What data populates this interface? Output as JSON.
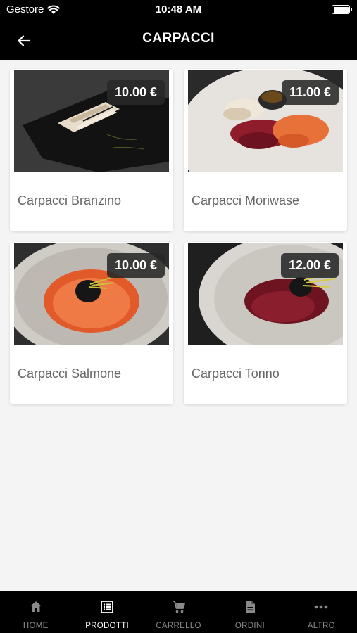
{
  "status": {
    "carrier": "Gestore",
    "time": "10:48 AM"
  },
  "header": {
    "title": "CARPACCI"
  },
  "products": [
    {
      "name": "Carpacci Branzino",
      "price": "10.00 €"
    },
    {
      "name": "Carpacci Moriwase",
      "price": "11.00 €"
    },
    {
      "name": "Carpacci Salmone",
      "price": "10.00 €"
    },
    {
      "name": "Carpacci Tonno",
      "price": "12.00 €"
    }
  ],
  "tabs": [
    {
      "label": "HOME",
      "icon": "home-icon"
    },
    {
      "label": "PRODOTTI",
      "icon": "list-icon",
      "active": true
    },
    {
      "label": "CARRELLO",
      "icon": "cart-icon"
    },
    {
      "label": "ORDINI",
      "icon": "document-icon"
    },
    {
      "label": "ALTRO",
      "icon": "more-icon"
    }
  ],
  "colors": {
    "bar": "#000000",
    "background": "#f4f4f4",
    "tab_active": "#ffffff",
    "tab_inactive": "#8a8a8a",
    "price_badge": "#282828"
  }
}
